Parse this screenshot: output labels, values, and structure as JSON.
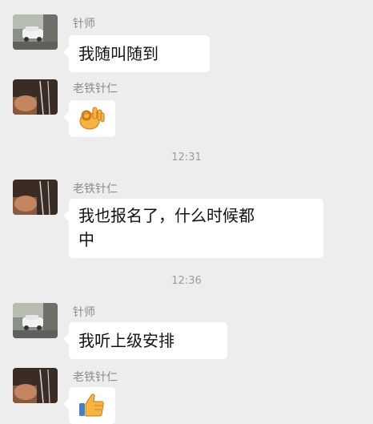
{
  "messages": [
    {
      "sender": "针师",
      "text": "我随叫随到",
      "avatar": "zhenshi-avatar"
    },
    {
      "sender": "老铁针仁",
      "sticker": "ok-hand-icon",
      "avatar": "laotie-avatar"
    },
    {
      "sender": "老铁针仁",
      "text_line1": "我也报名了，什么时候都",
      "text_line2": "中",
      "avatar": "laotie-avatar"
    },
    {
      "sender": "针师",
      "text": "我听上级安排",
      "avatar": "zhenshi-avatar"
    },
    {
      "sender": "老铁针仁",
      "sticker": "thumbs-up-icon",
      "avatar": "laotie-avatar"
    }
  ],
  "timestamps": [
    "12:31",
    "12:36"
  ],
  "colors": {
    "background": "#ededed",
    "bubble": "#ffffff",
    "meta_text": "#8b8b8b"
  }
}
